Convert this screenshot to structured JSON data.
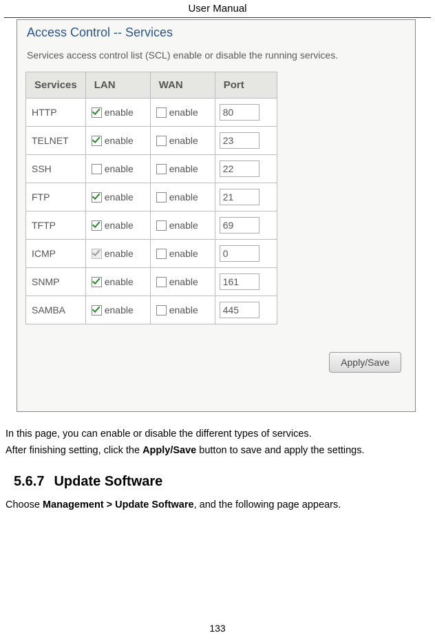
{
  "header": {
    "title": "User Manual"
  },
  "screenshot": {
    "title": "Access Control -- Services",
    "description": "Services access control list (SCL) enable or disable the running services.",
    "table": {
      "headers": [
        "Services",
        "LAN",
        "WAN",
        "Port"
      ],
      "enable_label": "enable",
      "rows": [
        {
          "service": "HTTP",
          "lan_checked": true,
          "lan_disabled": false,
          "wan_checked": false,
          "port": "80"
        },
        {
          "service": "TELNET",
          "lan_checked": true,
          "lan_disabled": false,
          "wan_checked": false,
          "port": "23"
        },
        {
          "service": "SSH",
          "lan_checked": false,
          "lan_disabled": false,
          "wan_checked": false,
          "port": "22"
        },
        {
          "service": "FTP",
          "lan_checked": true,
          "lan_disabled": false,
          "wan_checked": false,
          "port": "21"
        },
        {
          "service": "TFTP",
          "lan_checked": true,
          "lan_disabled": false,
          "wan_checked": false,
          "port": "69"
        },
        {
          "service": "ICMP",
          "lan_checked": true,
          "lan_disabled": true,
          "wan_checked": false,
          "port": "0"
        },
        {
          "service": "SNMP",
          "lan_checked": true,
          "lan_disabled": false,
          "wan_checked": false,
          "port": "161"
        },
        {
          "service": "SAMBA",
          "lan_checked": true,
          "lan_disabled": false,
          "wan_checked": false,
          "port": "445"
        }
      ]
    },
    "apply_button": "Apply/Save"
  },
  "body": {
    "para1": "In this page, you can enable or disable the different types of services.",
    "para2_pre": "After finishing setting, click the ",
    "para2_bold": "Apply/Save",
    "para2_post": " button to save and apply the settings."
  },
  "section": {
    "number": "5.6.7",
    "title": "Update Software",
    "text_pre": "Choose ",
    "text_bold": "Management > Update Software",
    "text_post": ", and the following page appears."
  },
  "page_number": "133"
}
